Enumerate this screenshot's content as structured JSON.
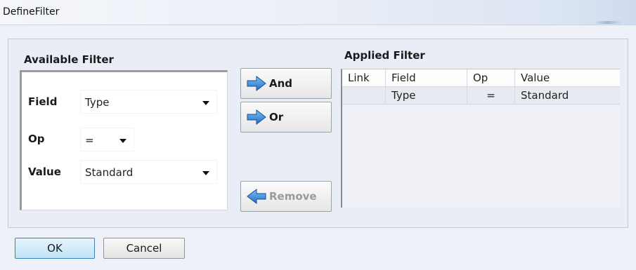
{
  "window": {
    "title": "DefineFilter"
  },
  "available": {
    "label": "Available Filter",
    "field": {
      "label": "Field",
      "value": "Type"
    },
    "op": {
      "label": "Op",
      "value": "="
    },
    "value": {
      "label": "Value",
      "value": "Standard"
    }
  },
  "actions": {
    "and_label": "And",
    "or_label": "Or",
    "remove_label": "Remove"
  },
  "applied": {
    "label": "Applied Filter",
    "columns": [
      "Link",
      "Field",
      "Op",
      "Value"
    ],
    "rows": [
      {
        "link": "",
        "field": "Type",
        "op": "=",
        "value": "Standard"
      }
    ]
  },
  "footer": {
    "ok_label": "OK",
    "cancel_label": "Cancel"
  },
  "colors": {
    "arrow_blue": "#2f7fd6",
    "default_button_border": "#3c7fb1"
  },
  "icons": {
    "add": "arrow-right-icon",
    "remove": "arrow-left-icon"
  }
}
